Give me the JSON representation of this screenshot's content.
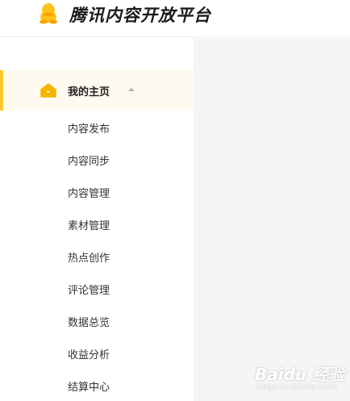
{
  "header": {
    "brand_title": "腾讯内容开放平台",
    "logo_icon": "qq-penguin-icon"
  },
  "sidebar": {
    "group": {
      "label": "我的主页",
      "icon": "home-icon",
      "expanded": true
    },
    "items": [
      {
        "label": "内容发布"
      },
      {
        "label": "内容同步"
      },
      {
        "label": "内容管理"
      },
      {
        "label": "素材管理"
      },
      {
        "label": "热点创作"
      },
      {
        "label": "评论管理"
      },
      {
        "label": "数据总览"
      },
      {
        "label": "收益分析"
      },
      {
        "label": "结算中心"
      }
    ]
  },
  "watermark": {
    "main": "Baidu 经验",
    "sub": "jingyan.baidu.com"
  },
  "colors": {
    "accent": "#ffc82c",
    "active_bg": "#fffaf0",
    "content_bg": "#f4f5f7",
    "text": "#333333"
  }
}
